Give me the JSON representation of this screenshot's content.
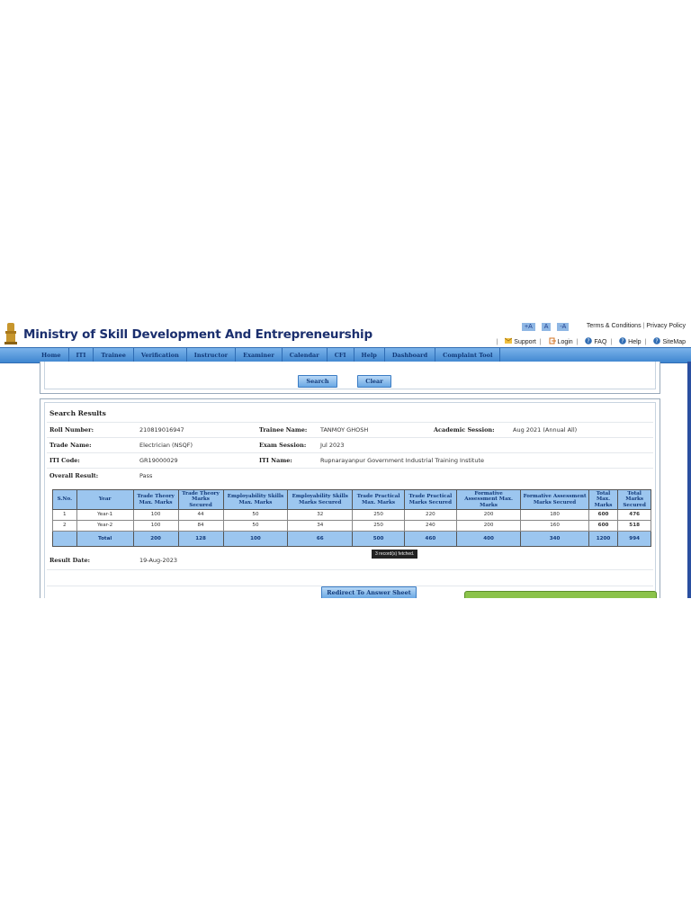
{
  "header": {
    "title": "Ministry of Skill Development And Entrepreneurship",
    "font_controls": [
      "+A",
      "A",
      "-A"
    ],
    "top_links": [
      "Terms & Conditions",
      "Privacy Policy"
    ],
    "util_links": [
      {
        "label": "Support",
        "icon": "envelope-icon"
      },
      {
        "label": "Login",
        "icon": "login-icon"
      },
      {
        "label": "FAQ",
        "icon": "help-circle-icon"
      },
      {
        "label": "Help",
        "icon": "help-circle-icon"
      },
      {
        "label": "SiteMap",
        "icon": "help-circle-icon"
      }
    ]
  },
  "nav": [
    "Home",
    "ITI",
    "Trainee",
    "Verification",
    "Instructor",
    "Examiner",
    "Calendar",
    "CFI",
    "Help",
    "Dashboard",
    "Complaint Tool"
  ],
  "search_panel": {
    "search_label": "Search",
    "clear_label": "Clear"
  },
  "results": {
    "title": "Search Results",
    "roll_number_label": "Roll Number:",
    "roll_number": "210819016947",
    "trainee_name_label": "Trainee Name:",
    "trainee_name": "TANMOY GHOSH",
    "academic_session_label": "Academic Session:",
    "academic_session": "Aug 2021 (Annual All)",
    "trade_name_label": "Trade Name:",
    "trade_name": "Electrician (NSQF)",
    "exam_session_label": "Exam Session:",
    "exam_session": "Jul 2023",
    "iti_code_label": "ITI Code:",
    "iti_code": "GR19000029",
    "iti_name_label": "ITI Name:",
    "iti_name": "Rupnarayanpur Government Industrial Training Institute",
    "overall_result_label": "Overall Result:",
    "overall_result": "Pass",
    "result_date_label": "Result Date:",
    "result_date": "19-Aug-2023",
    "redirect_label": "Redirect To Answer Sheet",
    "toast": "3 record(s) fetched."
  },
  "table": {
    "headers": [
      "S.No.",
      "Year",
      "Trade Theory Max. Marks",
      "Trade Theory Marks Secured",
      "Employability Skills Max. Marks",
      "Employability Skills Marks Secured",
      "Trade Practical Max. Marks",
      "Trade Practical Marks Secured",
      "Formative Assessment Max. Marks",
      "Formative Assessment Marks Secured",
      "Total Max. Marks",
      "Total Marks Secured"
    ],
    "rows": [
      [
        "1",
        "Year-1",
        "100",
        "44",
        "50",
        "32",
        "250",
        "220",
        "200",
        "180",
        "600",
        "476"
      ],
      [
        "2",
        "Year-2",
        "100",
        "84",
        "50",
        "34",
        "250",
        "240",
        "200",
        "160",
        "600",
        "518"
      ]
    ],
    "total": [
      "",
      "Total",
      "200",
      "128",
      "100",
      "66",
      "500",
      "460",
      "400",
      "340",
      "1200",
      "994"
    ]
  },
  "colors": {
    "nav_bg": "#4a8fd6",
    "header_title": "#1b2f6e",
    "table_header": "#9cc6ef",
    "green": "#8bc34a"
  }
}
